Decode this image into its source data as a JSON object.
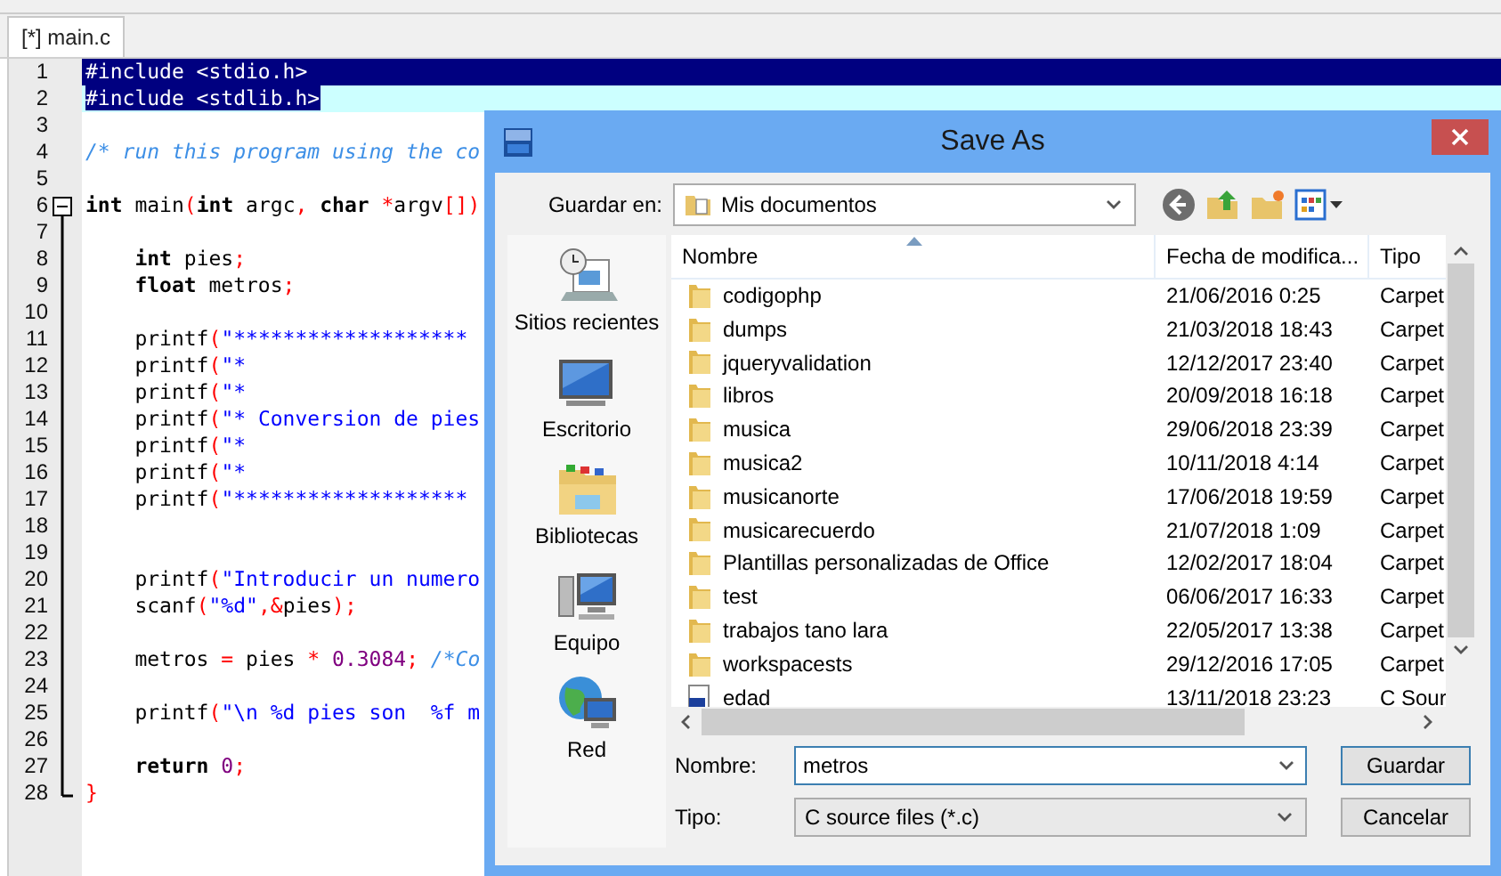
{
  "tabs": [
    {
      "label": "[*] main.c",
      "selected": true
    }
  ],
  "editor": {
    "lines": [
      {
        "number": "1",
        "selected": true,
        "current": false,
        "tokens": [
          {
            "kind": "pre",
            "text": "#include <stdio.h>"
          }
        ]
      },
      {
        "number": "2",
        "selected": true,
        "current": true,
        "tokens": [
          {
            "kind": "pre",
            "text": "#include <stdlib.h>"
          }
        ]
      },
      {
        "number": "3",
        "selected": false,
        "current": false
      },
      {
        "number": "4",
        "selected": false,
        "current": false,
        "tokens": [
          {
            "kind": "com",
            "text": "/* run this program using the co"
          }
        ]
      },
      {
        "number": "5",
        "selected": false,
        "current": false
      },
      {
        "number": "6",
        "selected": false,
        "current": false,
        "tokens": [
          {
            "kind": "kw",
            "text": "int"
          },
          {
            "kind": "id",
            "text": " main"
          },
          {
            "kind": "op",
            "text": "("
          },
          {
            "kind": "kw",
            "text": "int"
          },
          {
            "kind": "id",
            "text": " argc"
          },
          {
            "kind": "op",
            "text": ","
          },
          {
            "kind": "kw",
            "text": " char"
          },
          {
            "kind": "op",
            "text": " *"
          },
          {
            "kind": "id",
            "text": "argv"
          },
          {
            "kind": "op",
            "text": "[])"
          }
        ]
      },
      {
        "number": "7",
        "selected": false,
        "current": false
      },
      {
        "number": "8",
        "selected": false,
        "current": false,
        "tokens": [
          {
            "kind": "kw",
            "text": "    int"
          },
          {
            "kind": "id",
            "text": " pies"
          },
          {
            "kind": "op",
            "text": ";"
          }
        ]
      },
      {
        "number": "9",
        "selected": false,
        "current": false,
        "tokens": [
          {
            "kind": "kw",
            "text": "    float"
          },
          {
            "kind": "id",
            "text": " metros"
          },
          {
            "kind": "op",
            "text": ";"
          }
        ]
      },
      {
        "number": "10",
        "selected": false,
        "current": false
      },
      {
        "number": "11",
        "selected": false,
        "current": false,
        "tokens": [
          {
            "kind": "id",
            "text": "    printf"
          },
          {
            "kind": "op",
            "text": "("
          },
          {
            "kind": "str",
            "text": "\"*******************"
          }
        ]
      },
      {
        "number": "12",
        "selected": false,
        "current": false,
        "tokens": [
          {
            "kind": "id",
            "text": "    printf"
          },
          {
            "kind": "op",
            "text": "("
          },
          {
            "kind": "str",
            "text": "\"*"
          }
        ]
      },
      {
        "number": "13",
        "selected": false,
        "current": false,
        "tokens": [
          {
            "kind": "id",
            "text": "    printf"
          },
          {
            "kind": "op",
            "text": "("
          },
          {
            "kind": "str",
            "text": "\"*"
          }
        ]
      },
      {
        "number": "14",
        "selected": false,
        "current": false,
        "tokens": [
          {
            "kind": "id",
            "text": "    printf"
          },
          {
            "kind": "op",
            "text": "("
          },
          {
            "kind": "str",
            "text": "\"* Conversion de pies"
          }
        ]
      },
      {
        "number": "15",
        "selected": false,
        "current": false,
        "tokens": [
          {
            "kind": "id",
            "text": "    printf"
          },
          {
            "kind": "op",
            "text": "("
          },
          {
            "kind": "str",
            "text": "\"*"
          }
        ]
      },
      {
        "number": "16",
        "selected": false,
        "current": false,
        "tokens": [
          {
            "kind": "id",
            "text": "    printf"
          },
          {
            "kind": "op",
            "text": "("
          },
          {
            "kind": "str",
            "text": "\"*"
          }
        ]
      },
      {
        "number": "17",
        "selected": false,
        "current": false,
        "tokens": [
          {
            "kind": "id",
            "text": "    printf"
          },
          {
            "kind": "op",
            "text": "("
          },
          {
            "kind": "str",
            "text": "\"*******************"
          }
        ]
      },
      {
        "number": "18",
        "selected": false,
        "current": false
      },
      {
        "number": "19",
        "selected": false,
        "current": false
      },
      {
        "number": "20",
        "selected": false,
        "current": false,
        "tokens": [
          {
            "kind": "id",
            "text": "    printf"
          },
          {
            "kind": "op",
            "text": "("
          },
          {
            "kind": "str",
            "text": "\"Introducir un numero"
          }
        ]
      },
      {
        "number": "21",
        "selected": false,
        "current": false,
        "tokens": [
          {
            "kind": "id",
            "text": "    scanf"
          },
          {
            "kind": "op",
            "text": "("
          },
          {
            "kind": "str",
            "text": "\"%d\""
          },
          {
            "kind": "op",
            "text": ",&"
          },
          {
            "kind": "id",
            "text": "pies"
          },
          {
            "kind": "op",
            "text": ");"
          }
        ]
      },
      {
        "number": "22",
        "selected": false,
        "current": false
      },
      {
        "number": "23",
        "selected": false,
        "current": false,
        "tokens": [
          {
            "kind": "id",
            "text": "    metros "
          },
          {
            "kind": "op",
            "text": "="
          },
          {
            "kind": "id",
            "text": " pies "
          },
          {
            "kind": "op",
            "text": "*"
          },
          {
            "kind": "num",
            "text": " 0.3084"
          },
          {
            "kind": "op",
            "text": ";"
          },
          {
            "kind": "com",
            "text": " /*Co"
          }
        ]
      },
      {
        "number": "24",
        "selected": false,
        "current": false
      },
      {
        "number": "25",
        "selected": false,
        "current": false,
        "tokens": [
          {
            "kind": "id",
            "text": "    printf"
          },
          {
            "kind": "op",
            "text": "("
          },
          {
            "kind": "str",
            "text": "\"\\n %d pies son  %f m"
          }
        ]
      },
      {
        "number": "26",
        "selected": false,
        "current": false
      },
      {
        "number": "27",
        "selected": false,
        "current": false,
        "tokens": [
          {
            "kind": "kw",
            "text": "    return"
          },
          {
            "kind": "num",
            "text": " 0"
          },
          {
            "kind": "op",
            "text": ";"
          }
        ]
      },
      {
        "number": "28",
        "selected": false,
        "current": false,
        "tokens": [
          {
            "kind": "op",
            "text": "}"
          }
        ]
      }
    ]
  },
  "dialog": {
    "title": "Save As",
    "location_label": "Guardar en:",
    "location": "Mis documentos",
    "places": [
      {
        "label": "Sitios recientes",
        "kind": "recent"
      },
      {
        "label": "Escritorio",
        "kind": "desktop"
      },
      {
        "label": "Bibliotecas",
        "kind": "libraries"
      },
      {
        "label": "Equipo",
        "kind": "computer"
      },
      {
        "label": "Red",
        "kind": "network"
      }
    ],
    "columns": [
      {
        "label": "Nombre",
        "sorted": true
      },
      {
        "label": "Fecha de modifica...",
        "sorted": false
      },
      {
        "label": "Tipo",
        "sorted": false
      }
    ],
    "files": [
      {
        "name": "codigophp",
        "modified": "21/06/2016 0:25",
        "type": "Carpet",
        "kind": "folder"
      },
      {
        "name": "dumps",
        "modified": "21/03/2018 18:43",
        "type": "Carpet",
        "kind": "folder"
      },
      {
        "name": "jqueryvalidation",
        "modified": "12/12/2017 23:40",
        "type": "Carpet",
        "kind": "folder"
      },
      {
        "name": "libros",
        "modified": "20/09/2018 16:18",
        "type": "Carpet",
        "kind": "folder"
      },
      {
        "name": "musica",
        "modified": "29/06/2018 23:39",
        "type": "Carpet",
        "kind": "folder"
      },
      {
        "name": "musica2",
        "modified": "10/11/2018 4:14",
        "type": "Carpet",
        "kind": "folder"
      },
      {
        "name": "musicanorte",
        "modified": "17/06/2018 19:59",
        "type": "Carpet",
        "kind": "folder"
      },
      {
        "name": "musicarecuerdo",
        "modified": "21/07/2018 1:09",
        "type": "Carpet",
        "kind": "folder"
      },
      {
        "name": "Plantillas personalizadas de Office",
        "modified": "12/02/2017 18:04",
        "type": "Carpet",
        "kind": "folder"
      },
      {
        "name": "test",
        "modified": "06/06/2017 16:33",
        "type": "Carpet",
        "kind": "folder"
      },
      {
        "name": "trabajos tano lara",
        "modified": "22/05/2017 13:38",
        "type": "Carpet",
        "kind": "folder"
      },
      {
        "name": "workspacests",
        "modified": "29/12/2016 17:05",
        "type": "Carpet",
        "kind": "folder"
      },
      {
        "name": "edad",
        "modified": "13/11/2018 23:23",
        "type": "C Sour",
        "kind": "source"
      }
    ],
    "filename_label": "Nombre:",
    "filename": "metros",
    "type_label": "Tipo:",
    "file_type": "C source files (*.c)",
    "buttons": [
      {
        "label": "Guardar",
        "default": true
      },
      {
        "label": "Cancelar",
        "default": false
      }
    ]
  }
}
